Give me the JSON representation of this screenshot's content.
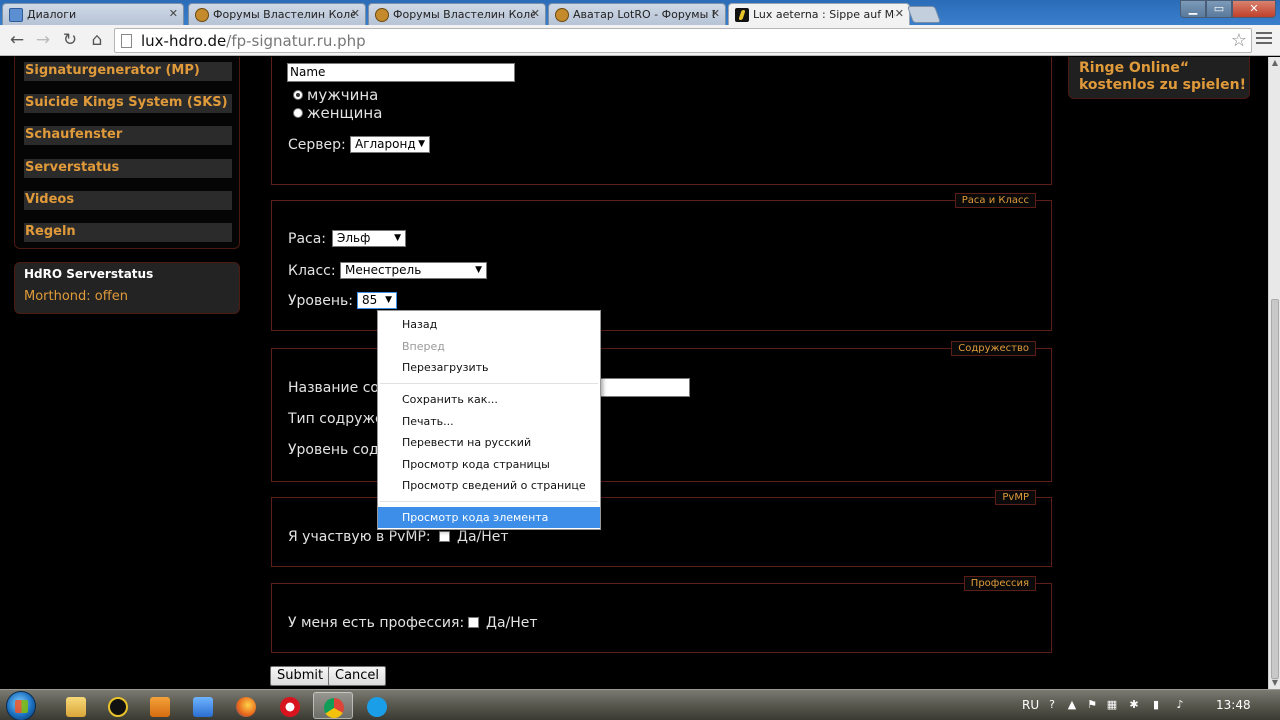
{
  "browser": {
    "tabs": [
      {
        "title": "Диалоги",
        "active": false
      },
      {
        "title": "Форумы Властелин Колец",
        "active": false
      },
      {
        "title": "Форумы Властелин Колец",
        "active": false
      },
      {
        "title": "Аватар LotRO - Форумы Властелин Колец",
        "active": false
      },
      {
        "title": "Lux aeterna : Sippe auf Morthond",
        "active": true
      }
    ],
    "url_host": "lux-hdro.de",
    "url_path": "/fp-signatur.ru.php"
  },
  "sidebar": {
    "links": [
      "Signaturgenerator (MP)",
      "Suicide Kings System (SKS)",
      "Schaufenster",
      "Serverstatus",
      "Videos",
      "Regeln"
    ],
    "status_title": "HdRO Serverstatus",
    "status_value": "Morthond: offen"
  },
  "right_banner": {
    "line1": "Ringe Online“",
    "line2": "kostenlos zu spielen!"
  },
  "form": {
    "name_value": "Name",
    "gender_male": "мужчина",
    "gender_female": "женщина",
    "server_label": "Сервер:",
    "server_value": "Агларонд",
    "race_class_legend": "Раса и Класс",
    "race_label": "Раса:",
    "race_value": "Эльф",
    "class_label": "Класс:",
    "class_value": "Менестрель",
    "level_label": "Уровень:",
    "level_value": "85",
    "fellowship_legend": "Содружество",
    "fellowship_name_label": "Название со",
    "fellowship_type_label": "Тип содруже",
    "fellowship_level_label": "Уровень содр",
    "pvmp_legend": "PvMP",
    "pvmp_label": "Я участвую в PvMP:",
    "pvmp_checkbox_label": "Да/Нет",
    "profession_legend": "Профессия",
    "profession_label": "У меня есть профессия:",
    "profession_checkbox_label": "Да/Нет",
    "submit_label": "Submit",
    "cancel_label": "Cancel"
  },
  "context_menu": {
    "back": "Назад",
    "forward": "Вперед",
    "reload": "Перезагрузить",
    "save_as": "Сохранить как...",
    "print": "Печать...",
    "translate": "Перевести на русский",
    "view_source": "Просмотр кода страницы",
    "page_info": "Просмотр  сведений о странице",
    "inspect": "Просмотр кода элемента"
  },
  "taskbar": {
    "language": "RU",
    "clock": "13:48"
  },
  "colors": {
    "accent_orange": "#e09a3a",
    "panel_border": "#5c1e16",
    "menu_highlight": "#3d8ee8"
  }
}
